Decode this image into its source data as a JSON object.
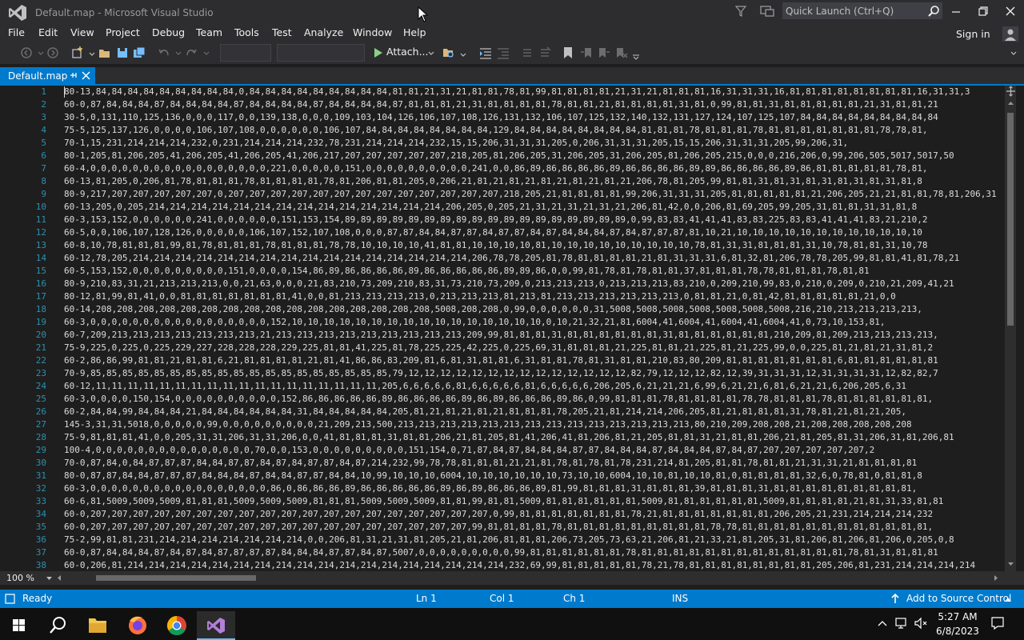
{
  "window": {
    "title": "Default.map - Microsoft Visual Studio",
    "quick_launch_placeholder": "Quick Launch (Ctrl+Q)"
  },
  "menu": {
    "items": [
      "File",
      "Edit",
      "View",
      "Project",
      "Debug",
      "Team",
      "Tools",
      "Test",
      "Analyze",
      "Window",
      "Help"
    ],
    "sign_in": "Sign in"
  },
  "toolbar": {
    "attach_label": "Attach..."
  },
  "tab": {
    "label": "Default.map"
  },
  "editor": {
    "zoom": "100 %",
    "line_numbers": [
      "1",
      "2",
      "3",
      "4",
      "5",
      "6",
      "7",
      "8",
      "9",
      "10",
      "11",
      "12",
      "13",
      "14",
      "15",
      "16",
      "17",
      "18",
      "19",
      "20",
      "21",
      "22",
      "23",
      "24",
      "25",
      "26",
      "27",
      "28",
      "29",
      "30",
      "31",
      "32",
      "33",
      "34",
      "35",
      "36",
      "37",
      "38"
    ],
    "lines": [
      "80-13,84,84,84,84,84,84,84,84,84,0,84,84,84,84,84,84,84,84,84,81,81,21,31,21,81,81,78,81,99,81,81,81,81,21,31,21,81,81,81,16,31,31,31,16,81,81,81,81,81,81,81,81,16,31,31,3",
      "60-0,87,84,84,84,87,84,84,84,84,87,84,84,84,84,87,84,84,84,84,87,81,81,81,21,31,81,81,81,81,78,81,81,21,81,81,81,81,31,81,0,99,81,81,31,81,81,81,81,81,21,31,81,81,21",
      "30-5,0,131,110,125,136,0,0,0,117,0,0,139,138,0,0,0,109,103,104,126,106,107,108,126,131,132,106,107,125,132,140,132,131,127,124,107,125,107,84,84,84,84,84,84,84,84,84",
      "75-5,125,137,126,0,0,0,0,106,107,108,0,0,0,0,0,0,106,107,84,84,84,84,84,84,84,84,129,84,84,84,84,84,84,84,84,81,81,81,78,81,81,81,78,81,81,81,81,81,81,81,78,78,81,",
      "70-1,15,231,214,214,214,232,0,231,214,214,214,232,78,231,214,214,214,232,15,15,206,31,31,31,205,0,206,31,31,31,205,15,15,206,31,31,31,205,99,206,31,",
      "80-1,205,81,206,205,41,206,205,41,206,205,41,206,217,207,207,207,207,207,218,205,81,206,205,31,206,205,31,206,205,81,206,205,215,0,0,0,216,206,0,99,206,505,5017,5017,50",
      "60-4,0,0,0,0,0,0,0,0,0,0,0,0,0,0,0,0,0,221,0,0,0,0,0,151,0,0,0,0,0,0,0,0,0,0,241,0,0,86,89,86,86,86,86,89,86,86,86,86,89,89,86,86,86,86,89,86,81,81,81,81,81,78,81,",
      "60-13,81,205,0,206,81,78,81,81,81,78,81,81,81,81,78,81,206,81,81,205,0,206,21,81,21,81,21,81,21,81,21,81,21,206,78,81,205,99,81,81,31,81,31,81,31,81,31,81,31,81,8",
      "80-9,217,207,207,207,207,207,0,207,207,207,207,207,207,207,207,207,207,207,207,207,218,205,21,81,81,81,81,99,206,31,31,31,205,81,81,81,81,81,21,206,205,21,21,81,81,78,81,206,31",
      "60-13,205,0,205,214,214,214,214,214,214,214,214,214,214,214,214,214,214,206,205,0,205,21,31,21,31,21,31,21,206,81,42,0,0,206,81,69,205,99,205,31,81,81,31,31,81,8",
      "60-3,153,152,0,0,0,0,0,0,241,0,0,0,0,0,0,151,153,154,89,89,89,89,89,89,89,89,89,89,89,89,89,89,89,89,89,89,0,99,83,83,41,41,41,83,83,225,83,83,41,41,41,83,21,210,2",
      "60-5,0,0,106,107,128,126,0,0,0,0,0,106,107,152,107,108,0,0,0,87,87,84,84,87,87,84,87,87,84,87,84,84,84,87,84,87,87,87,81,10,21,10,10,10,10,10,10,10,10,10,10,10,10",
      "60-8,10,78,81,81,81,99,81,78,81,81,81,78,81,81,81,78,78,10,10,10,10,41,81,81,10,10,10,10,81,10,10,10,10,10,10,10,10,10,78,81,31,31,81,81,81,31,10,78,81,81,31,10,78",
      "60-12,78,205,214,214,214,214,214,214,214,214,214,214,214,214,214,214,214,214,206,78,78,205,81,78,81,81,81,81,21,81,31,31,31,6,81,32,81,206,78,78,205,99,81,81,41,81,78,21",
      "60-5,153,152,0,0,0,0,0,0,0,0,0,151,0,0,0,0,154,86,89,86,86,86,86,89,86,86,86,86,86,89,89,86,0,0,99,81,78,81,78,81,81,37,81,81,81,78,78,81,81,81,78,81,81",
      "80-9,210,83,31,21,213,213,213,0,0,21,63,0,0,0,21,83,210,73,209,210,83,31,73,210,73,209,0,213,213,213,0,213,213,213,83,210,0,209,210,99,83,0,210,0,209,0,210,21,209,41,21",
      "80-12,81,99,81,41,0,0,81,81,81,81,81,81,81,41,0,0,81,213,213,213,213,0,213,213,213,81,213,81,213,213,213,213,213,213,0,81,81,21,0,81,42,81,81,81,81,81,21,0,0",
      "60-14,208,208,208,208,208,208,208,208,208,208,208,208,208,208,208,208,5008,208,208,0,99,0,0,0,0,0,0,31,5008,5008,5008,5008,5008,5008,5008,216,210,213,213,213,213,",
      "60-3,0,0,0,0,0,0,0,0,0,0,0,0,0,0,0,0,0,152,10,10,10,10,10,10,10,10,10,10,10,10,10,10,10,10,0,10,21,32,21,81,6004,41,6004,41,6004,41,6004,41,0,73,10,153,81,",
      "60-7,209,213,213,213,213,213,213,213,21,213,213,213,213,213,213,213,213,213,209,99,81,81,81,31,81,81,81,81,81,81,31,81,81,81,81,81,81,210,209,81,209,213,213,213,213,",
      "75-9,225,0,225,0,225,229,227,228,228,228,229,225,81,81,41,225,81,78,225,225,42,225,0,225,69,31,81,81,81,21,225,81,81,21,225,81,21,225,99,0,0,225,81,21,81,21,31,81,2",
      "60-2,86,86,99,81,81,21,81,81,6,21,81,81,81,81,21,81,41,86,86,83,209,81,6,81,31,81,81,6,31,81,81,78,81,31,81,81,210,83,80,209,81,81,81,81,81,81,81,6,81,81,81,81,81,81",
      "70-9,85,85,85,85,85,85,85,85,85,85,85,85,85,85,85,85,85,85,85,79,12,12,12,12,12,12,12,12,12,12,12,12,12,12,82,79,12,12,12,82,12,39,31,31,31,12,31,31,31,31,12,82,82,7",
      "60-12,11,11,11,11,11,11,11,11,11,11,11,11,11,11,11,11,11,11,205,6,6,6,6,6,81,6,6,6,6,6,81,6,6,6,6,6,206,205,6,21,21,21,6,99,6,21,21,6,81,6,21,21,6,206,205,6,31",
      "60-3,0,0,0,0,150,154,0,0,0,0,0,0,0,0,0,0,152,86,86,86,86,86,89,86,86,86,86,89,86,89,86,86,86,89,86,0,99,81,81,81,78,81,81,81,81,78,78,81,81,81,78,81,81,81,81,81,81,",
      "60-2,84,84,99,84,84,84,21,84,84,84,84,84,84,31,84,84,84,84,84,205,81,21,81,21,81,21,81,81,81,78,205,21,81,214,214,206,205,81,21,81,81,81,31,78,81,21,81,21,205,",
      "145-3,31,31,5018,0,0,0,0,0,99,0,0,0,0,0,0,0,0,0,21,209,213,500,213,213,213,213,213,213,213,213,213,213,213,213,213,213,80,210,209,208,208,21,208,208,208,208,208",
      "75-9,81,81,81,41,0,0,205,31,31,206,31,31,206,0,0,41,81,81,81,31,81,81,206,21,81,205,81,41,206,41,81,206,81,21,205,81,81,31,21,81,81,206,21,81,205,81,31,206,31,81,206,81",
      "100-4,0,0,0,0,0,0,0,0,0,0,0,0,0,0,0,70,0,0,153,0,0,0,0,0,0,0,0,0,151,154,0,71,87,84,87,84,84,84,87,87,84,84,84,87,84,84,84,87,84,87,207,207,207,207,207,2",
      "70-0,87,84,0,84,87,87,87,84,84,87,87,84,87,84,87,87,84,87,214,232,99,78,78,81,81,81,21,21,81,78,81,78,81,78,231,214,81,205,81,81,78,81,81,21,31,31,21,81,81,81,81",
      "80-0,87,87,84,84,87,87,87,84,84,84,87,84,84,87,87,84,84,10,99,10,10,10,6004,10,10,10,10,10,10,73,10,10,6004,10,10,81,10,10,81,0,81,81,81,81,32,6,0,78,81,0,81,81,8",
      "60-3,0,0,0,0,0,0,0,0,0,0,0,0,0,0,0,0,0,86,0,86,86,86,89,86,86,86,86,86,89,86,89,86,86,86,89,81,99,81,81,81,31,81,81,81,39,81,81,81,31,81,81,81,81,81,81,81,81,81,",
      "60-6,81,5009,5009,5009,81,81,81,5009,5009,5009,81,81,81,5009,5009,5009,81,81,99,81,81,5009,81,81,81,81,81,81,5009,81,81,81,81,81,81,5009,81,81,81,81,21,81,31,33,81,81",
      "60-0,207,207,207,207,207,207,207,207,207,207,207,207,207,207,207,207,207,207,207,0,99,81,81,81,81,81,81,81,78,21,81,81,81,81,81,81,81,206,205,21,231,214,214,214,232",
      "60-0,207,207,207,207,207,207,207,207,207,207,207,207,207,207,207,207,207,207,99,81,81,81,81,78,81,81,81,81,81,81,81,81,81,78,78,81,81,81,81,81,81,81,81,81,81,81,81,",
      "75-2,99,81,81,231,214,214,214,214,214,214,214,0,0,206,81,31,21,31,81,205,21,81,206,81,81,81,206,73,205,73,63,21,206,81,21,33,21,81,205,31,81,206,81,206,81,206,0,205,0,8",
      "60-0,87,84,84,84,87,84,87,84,87,87,87,87,84,84,84,87,87,84,87,5007,0,0,0,0,0,0,0,0,0,99,81,81,81,81,81,81,78,81,81,81,81,81,81,81,81,81,81,81,81,81,78,81,31,81,81,81",
      "60-0,206,81,214,214,214,214,214,214,214,214,214,214,214,214,214,214,214,214,214,214,232,69,99,81,81,81,81,81,78,21,78,81,81,81,81,81,81,81,81,205,206,81,231,214,214,214,214"
    ]
  },
  "statusbar": {
    "ready": "Ready",
    "ln": "Ln 1",
    "col": "Col 1",
    "ch": "Ch 1",
    "ins": "INS",
    "source_control": "Add to Source Control"
  },
  "taskbar": {
    "time": "5:27 AM",
    "date": "6/8/2023"
  }
}
